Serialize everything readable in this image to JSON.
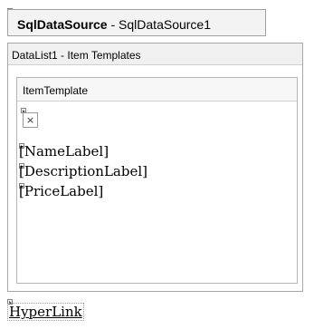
{
  "sql_data_source": {
    "control_type": "SqlDataSource",
    "separator": " - ",
    "control_id": "SqlDataSource1"
  },
  "datalist": {
    "header": "DataList1 - Item Templates",
    "template": {
      "name": "ItemTemplate",
      "image_placeholder_icon": "broken-image-icon",
      "image_glyph": "×",
      "labels": [
        "[NameLabel]",
        "[DescriptionLabel]",
        "[PriceLabel]"
      ]
    }
  },
  "hyperlink": {
    "text": "HyperLink"
  }
}
